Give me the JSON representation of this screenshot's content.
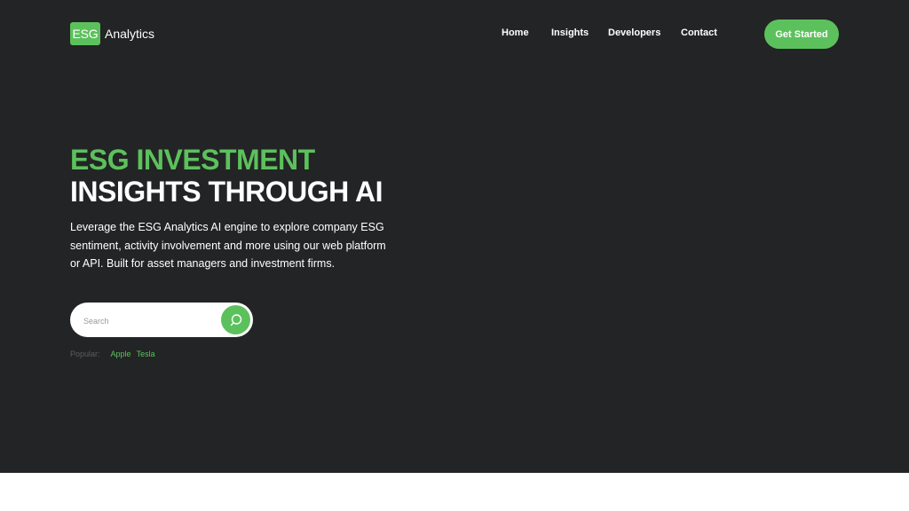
{
  "brand": {
    "logo_mark": "ESG",
    "name": "Analytics"
  },
  "nav": {
    "items": [
      {
        "label": "Home"
      },
      {
        "label": "Insights"
      },
      {
        "label": "Developers"
      },
      {
        "label": "Contact"
      }
    ]
  },
  "cta_label": "Get Started",
  "hero": {
    "title_line1": "ESG INVESTMENT",
    "title_line2": "INSIGHTS THROUGH AI",
    "description": "Leverage the ESG Analytics AI engine to explore company ESG sentiment, activity involvement and more using our web platform or API. Built for asset managers and investment firms."
  },
  "search": {
    "placeholder": "Search",
    "value": "",
    "button_icon": "search-icon"
  },
  "popular": {
    "label": "Popular:",
    "tags": [
      "Apple",
      "Tesla"
    ]
  },
  "colors": {
    "accent": "#5cc15c",
    "background": "#232425",
    "footer": "#ffffff"
  }
}
